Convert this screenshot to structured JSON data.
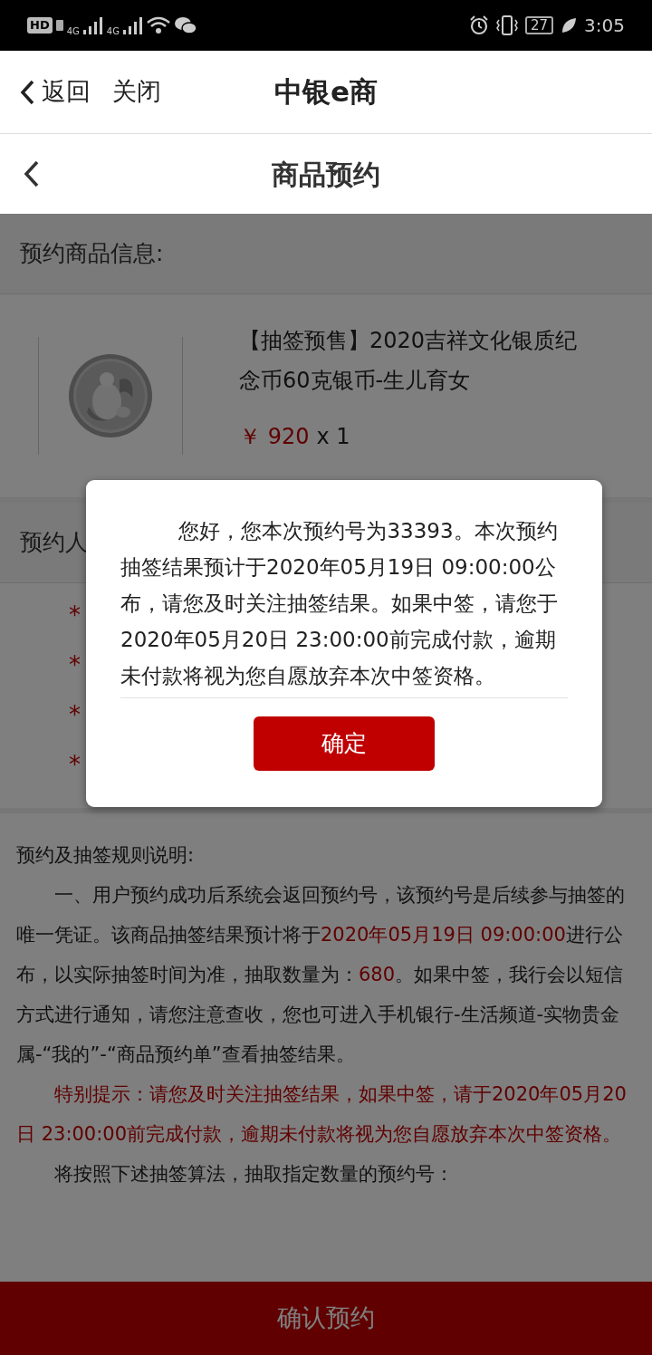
{
  "status_bar": {
    "hd": "HD",
    "network_labels": [
      "4G",
      "4G"
    ],
    "battery": "27",
    "time": "3:05"
  },
  "top_bar": {
    "back": "返回",
    "close": "关闭",
    "title": "中银e商"
  },
  "nav_bar": {
    "title": "商品预约"
  },
  "product_section": {
    "heading": "预约商品信息:",
    "product": {
      "kind": "picture",
      "name": "【抽签预售】2020吉祥文化银质纪念币60克银币-生儿育女",
      "currency": "￥",
      "price": "920",
      "quantity": "x 1"
    }
  },
  "reserver_section": {
    "heading": "预约人",
    "required_marks": [
      "*",
      "*",
      "*",
      "*"
    ]
  },
  "rules": {
    "heading": "预约及抽签规则说明:",
    "paragraphs": [
      {
        "kind": "mixed",
        "segments": [
          {
            "text": "一、用户预约成功后系统会返回预约号，该预约号是后续参与抽签的唯一凭证。该商品抽签结果预计将于",
            "highlight": false
          },
          {
            "text": "2020年05月19日 09:00:00",
            "highlight": true
          },
          {
            "text": "进行公布，以实际抽签时间为准，抽取数量为：",
            "highlight": false
          },
          {
            "text": "680",
            "highlight": true
          },
          {
            "text": "。如果中签，我行会以短信方式进行通知，请您注意查收，您也可进入手机银行-生活频道-实物贵金属-“我的”-“商品预约单”查看抽签结果。",
            "highlight": false
          }
        ]
      },
      {
        "kind": "mixed",
        "segments": [
          {
            "text": "特别提示：请您及时关注抽签结果，如果中签，请于2020年05月20日 23:00:00前完成付款，逾期未付款将视为您自愿放弃本次中签资格。",
            "highlight": true
          }
        ]
      },
      {
        "kind": "mixed",
        "segments": [
          {
            "text": "将按照下述抽签算法，抽取指定数量的预约号：",
            "highlight": false
          }
        ]
      }
    ]
  },
  "confirm_button": "确认预约",
  "dialog": {
    "message": "您好，您本次预约号为33393。本次预约抽签结果预计于2020年05月19日 09:00:00公布，请您及时关注抽签结果。如果中签，请您于2020年05月20日 23:00:00前完成付款，逾期未付款将视为您自愿放弃本次中签资格。",
    "ok_button": "确定"
  }
}
